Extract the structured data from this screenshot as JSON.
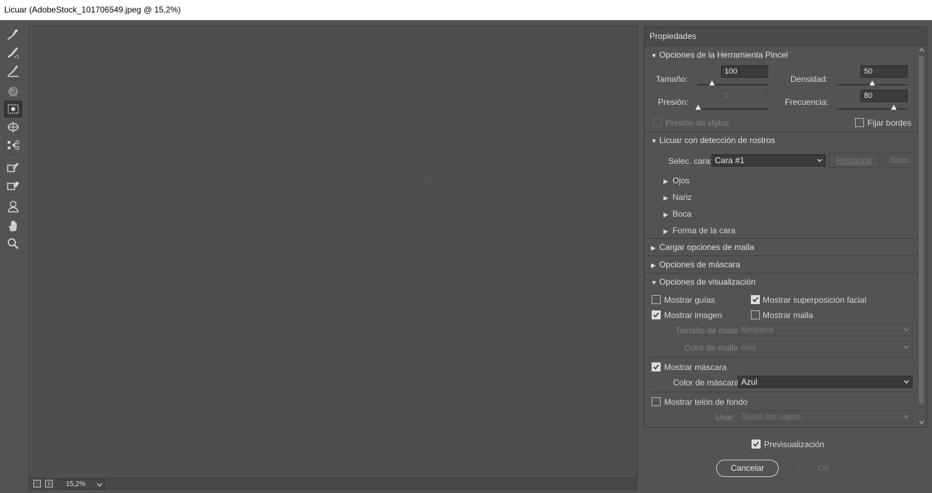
{
  "window": {
    "title": "Licuar (AdobeStock_101706549.jpeg @ 15,2%)"
  },
  "tools": [
    "forward-warp-icon",
    "reconstruct-icon",
    "smooth-icon",
    "twirl-icon",
    "pucker-icon",
    "bloat-icon",
    "push-left-icon",
    "freeze-mask-icon",
    "thaw-mask-icon",
    "face-tool-icon",
    "hand-icon",
    "zoom-icon"
  ],
  "status": {
    "zoom": "15,2%"
  },
  "panel": {
    "title": "Propiedades",
    "brush": {
      "header": "Opciones de la Herramienta Pincel",
      "size_label": "Tamaño:",
      "size_value": "100",
      "size_level": 0.2,
      "density_label": "Densidad:",
      "density_value": "50",
      "density_level": 0.5,
      "pressure_label": "Presión:",
      "pressure_value": "1",
      "pressure_level": 0.0,
      "rate_label": "Frecuencia:",
      "rate_value": "80",
      "rate_level": 0.8,
      "stylus_label": "Presión de stylus",
      "pin_edges_label": "Fijar bordes"
    },
    "face": {
      "header": "Licuar con detección de rostros",
      "select_label": "Selec. cara:",
      "select_value": "Cara #1",
      "reset_label": "Restaurar",
      "all_label": "Todo",
      "items": [
        "Ojos",
        "Nariz",
        "Boca",
        "Forma de la cara"
      ]
    },
    "load_mesh": "Cargar opciones de malla",
    "mask_options": "Opciones de máscara",
    "view": {
      "header": "Opciones de visualización",
      "show_guides": "Mostrar guías",
      "show_face_overlay": "Mostrar superposición facial",
      "show_image": "Mostrar imagen",
      "show_mesh": "Mostrar malla",
      "mesh_size_label": "Tamaño de malla:",
      "mesh_size_value": "Mediana",
      "mesh_color_label": "Color de malla:",
      "mesh_color_value": "Gris",
      "show_mask": "Mostrar máscara",
      "mask_color_label": "Color de máscara:",
      "mask_color_value": "Azul",
      "show_backdrop": "Mostrar telón de fondo",
      "use_label": "Usar:",
      "use_value": "Todas las capas"
    }
  },
  "footer": {
    "preview_label": "Previsualización",
    "cancel_label": "Cancelar",
    "ok_label": "OK"
  }
}
